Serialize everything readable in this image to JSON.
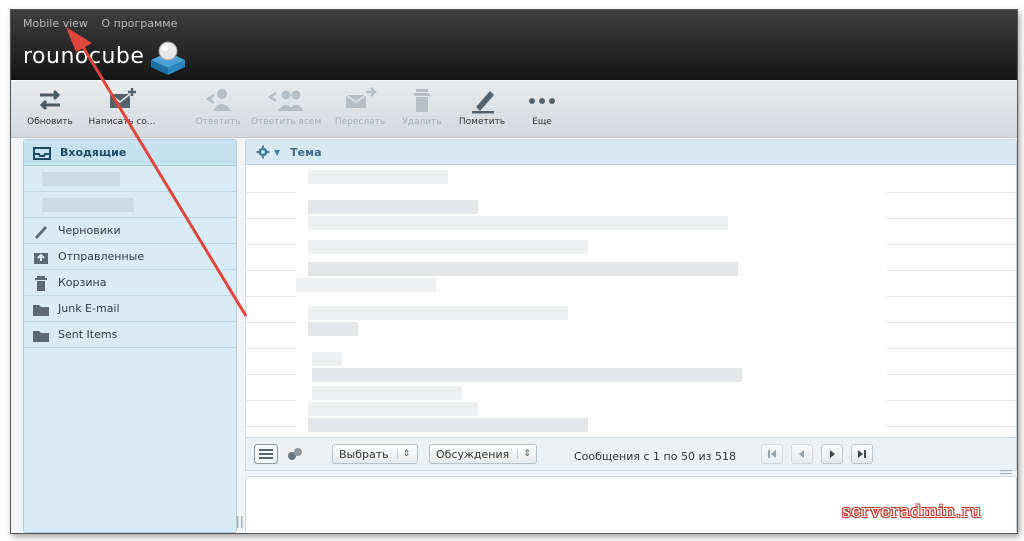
{
  "top_links": [
    "Mobile view",
    "О программе"
  ],
  "logo": {
    "text": "rounocube",
    "icon": "roundcube-cube-icon"
  },
  "toolbar": [
    {
      "label": "Обновить",
      "icon": "refresh-icon",
      "enabled": true
    },
    {
      "label": "Написать со...",
      "icon": "compose-icon",
      "enabled": true
    },
    {
      "label": "Ответить",
      "icon": "reply-icon",
      "enabled": false
    },
    {
      "label": "Ответить всем",
      "icon": "reply-all-icon",
      "enabled": false
    },
    {
      "label": "Переслать",
      "icon": "forward-icon",
      "enabled": false
    },
    {
      "label": "Удалить",
      "icon": "delete-icon",
      "enabled": false
    },
    {
      "label": "Пометить",
      "icon": "mark-icon",
      "enabled": true
    },
    {
      "label": "Еще",
      "icon": "more-icon",
      "enabled": true
    }
  ],
  "sidebar": {
    "inbox": "Входящие",
    "folders": [
      {
        "label": "Черновики",
        "icon": "pencil-icon"
      },
      {
        "label": "Отправленные",
        "icon": "sent-icon"
      },
      {
        "label": "Корзина",
        "icon": "trash-icon"
      },
      {
        "label": "Junk E-mail",
        "icon": "folder-icon"
      },
      {
        "label": "Sent Items",
        "icon": "folder-icon"
      }
    ]
  },
  "list": {
    "column_subject": "Тема"
  },
  "footer": {
    "select_label": "Выбрать",
    "threads_label": "Обсуждения",
    "pager_text": "Сообщения с 1 по 50 из 518"
  },
  "watermark": "serveradmin.ru",
  "colors": {
    "accent": "#3c6a86",
    "arrow": "#e0463c",
    "topbar": "#1e1e1e"
  }
}
